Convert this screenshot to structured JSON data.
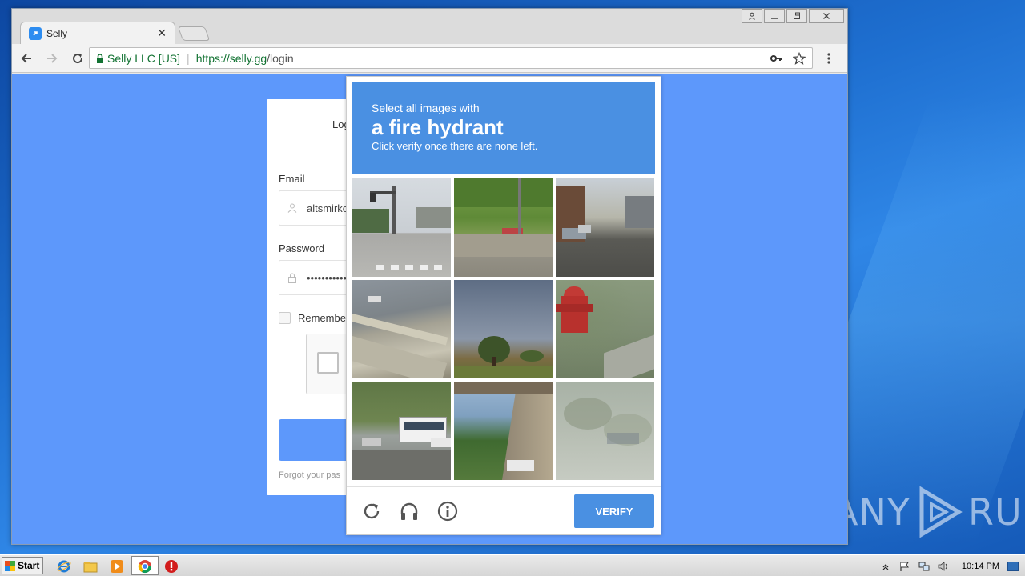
{
  "browser": {
    "tab_title": "Selly",
    "security_label": "Selly LLC [US]",
    "url_scheme_host": "https://selly.gg",
    "url_path": "/login"
  },
  "login": {
    "title_partial": "Log",
    "email_label": "Email",
    "email_value": "altsmirko",
    "password_label": "Password",
    "password_value": "•••••••••••",
    "remember_label": "Remember",
    "forgot_partial": "Forgot your pas"
  },
  "captcha": {
    "instruction_line1": "Select all images with",
    "target_object": "a fire hydrant",
    "instruction_line3": "Click verify once there are none left.",
    "verify_label": "VERIFY",
    "icons": [
      "reload-icon",
      "headphones-icon",
      "info-icon"
    ],
    "tiles": [
      "street-intersection",
      "hill-with-wall",
      "residential-street",
      "highway-barrier",
      "park-trees",
      "fire-hydrant",
      "bus-parking",
      "overpass-trees",
      "faded-trees"
    ]
  },
  "watermark": {
    "text_left": "ANY",
    "text_right": "RUN"
  },
  "taskbar": {
    "start_label": "Start",
    "clock": "10:14 PM"
  }
}
